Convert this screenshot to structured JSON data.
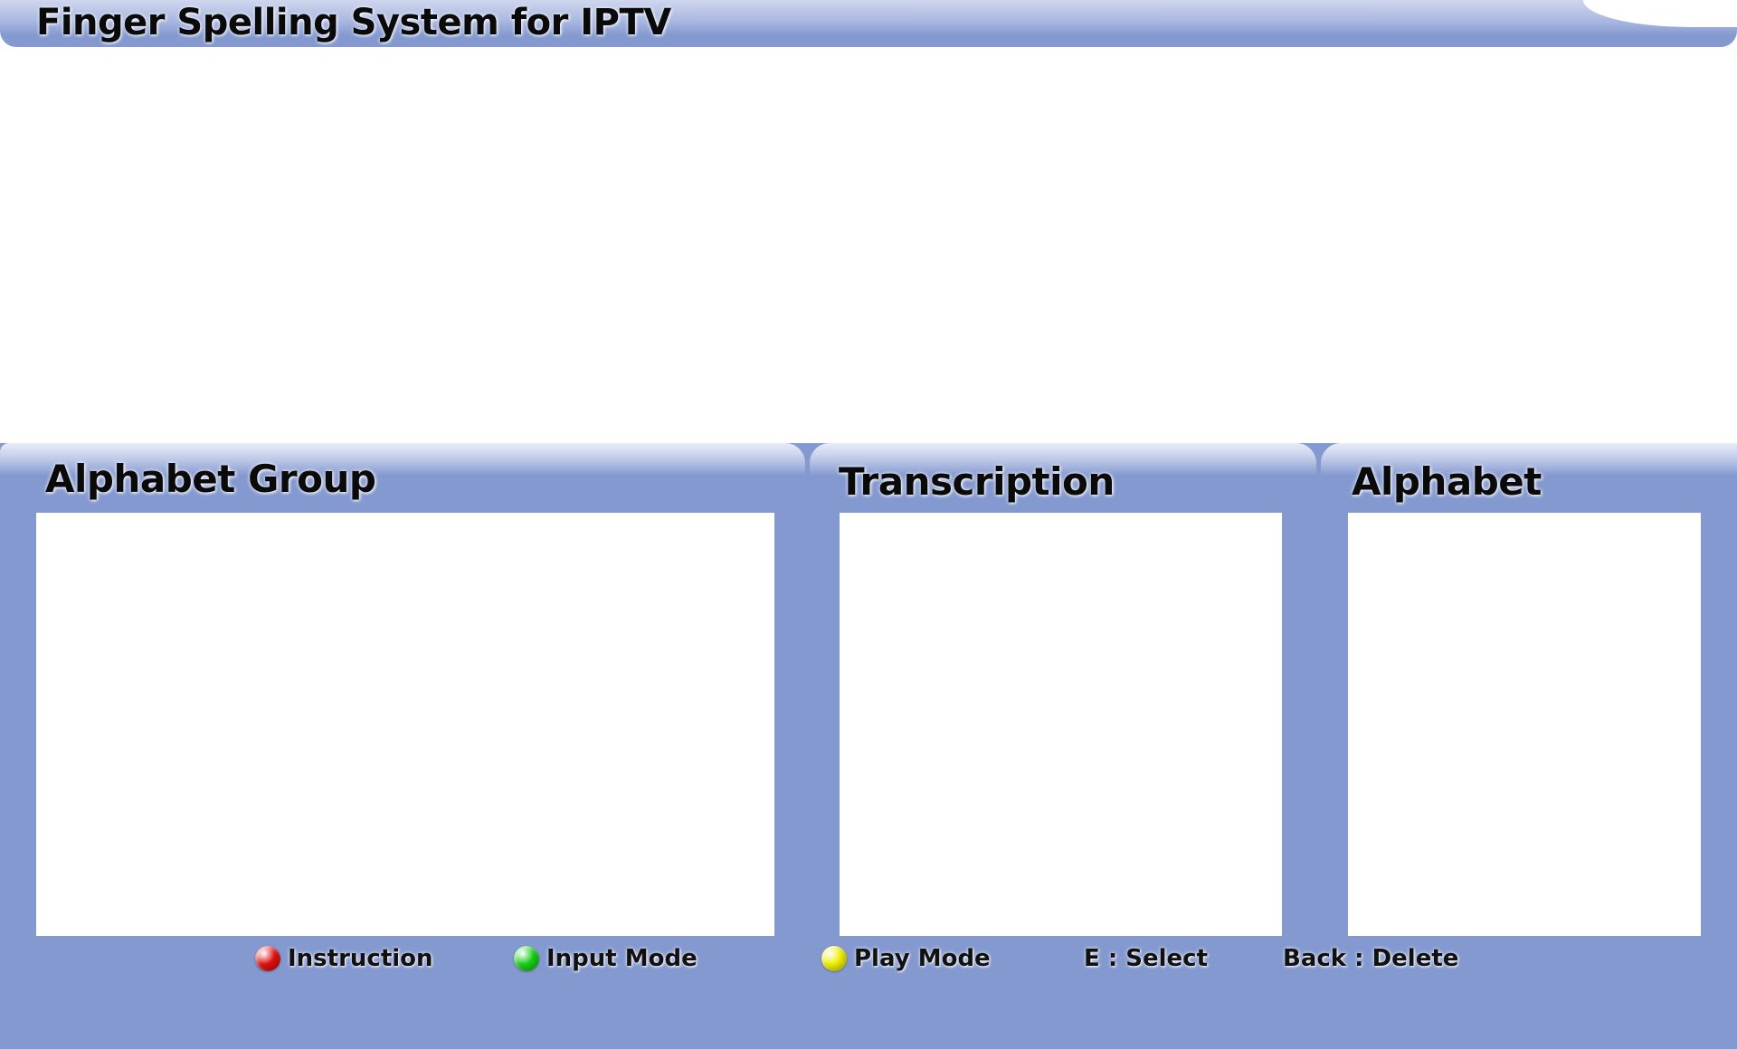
{
  "header": {
    "title": "Finger Spelling System for IPTV"
  },
  "panels": {
    "alphabet_group": {
      "title": "Alphabet Group"
    },
    "transcription": {
      "title": "Transcription"
    },
    "alphabet": {
      "title": "Alphabet"
    }
  },
  "footer": {
    "instruction": {
      "label": "Instruction",
      "color": "#e01010"
    },
    "input_mode": {
      "label": "Input Mode",
      "color": "#18d018"
    },
    "play_mode": {
      "label": "Play Mode",
      "color": "#f0f000"
    },
    "select": {
      "label": "E : Select"
    },
    "delete": {
      "label": "Back : Delete"
    }
  },
  "colors": {
    "panel": "#8499cf",
    "box": "#ffffff"
  }
}
